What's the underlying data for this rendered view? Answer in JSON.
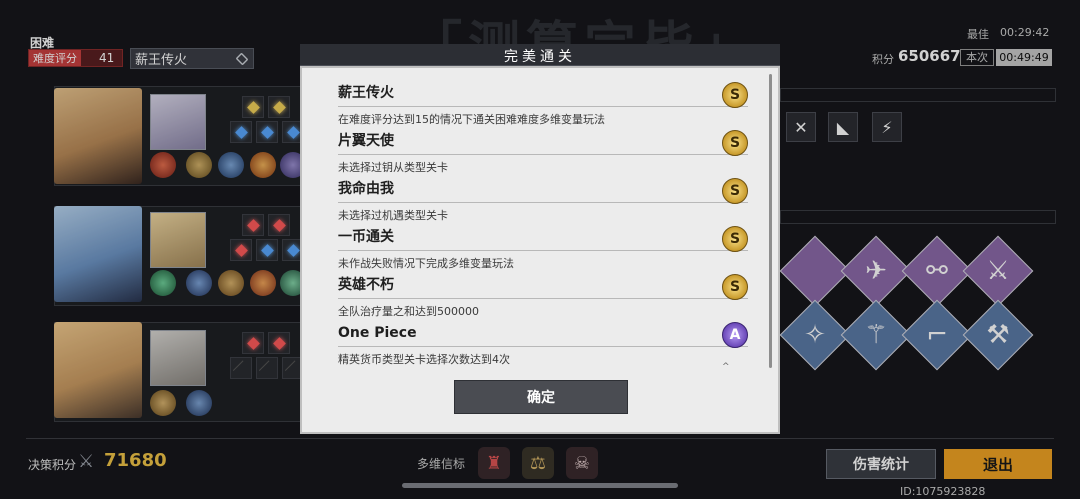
{
  "background_title": "「测算完毕」",
  "header": {
    "difficulty": "困难",
    "difficulty_tag": "难度评分",
    "difficulty_score": "41",
    "mode": "薪王传火",
    "best_label": "最佳",
    "best_time": "00:29:42",
    "score_label": "积分",
    "score": "650667",
    "current_label": "本次",
    "current_time": "00:49:49"
  },
  "modal": {
    "title": "完美通关",
    "achievements": [
      {
        "name": "薪王传火",
        "desc": "在难度评分达到15的情况下通关困难难度多维变量玩法",
        "medal": "S"
      },
      {
        "name": "片翼天使",
        "desc": "未选择过钥从类型关卡",
        "medal": "S"
      },
      {
        "name": "我命由我",
        "desc": "未选择过机遇类型关卡",
        "medal": "S"
      },
      {
        "name": "一币通关",
        "desc": "未作战失败情况下完成多维变量玩法",
        "medal": "S"
      },
      {
        "name": "英雄不朽",
        "desc": "全队治疗量之和达到500000",
        "medal": "S"
      },
      {
        "name": "One Piece",
        "desc": "精英货币类型关卡选择次数达到4次",
        "medal": "A"
      }
    ],
    "confirm_label": "确定",
    "more_mark": "^"
  },
  "footer": {
    "decision_label": "决策积分",
    "decision_score": "71680",
    "beacon_label": "多维信标",
    "stats_button": "伤害统计",
    "exit_button": "退出",
    "user_id": "ID:1075923828"
  },
  "colors": {
    "accent_exit": "#f0a324",
    "decision_gold": "#f0c447",
    "difficulty_red": "#c94040"
  }
}
